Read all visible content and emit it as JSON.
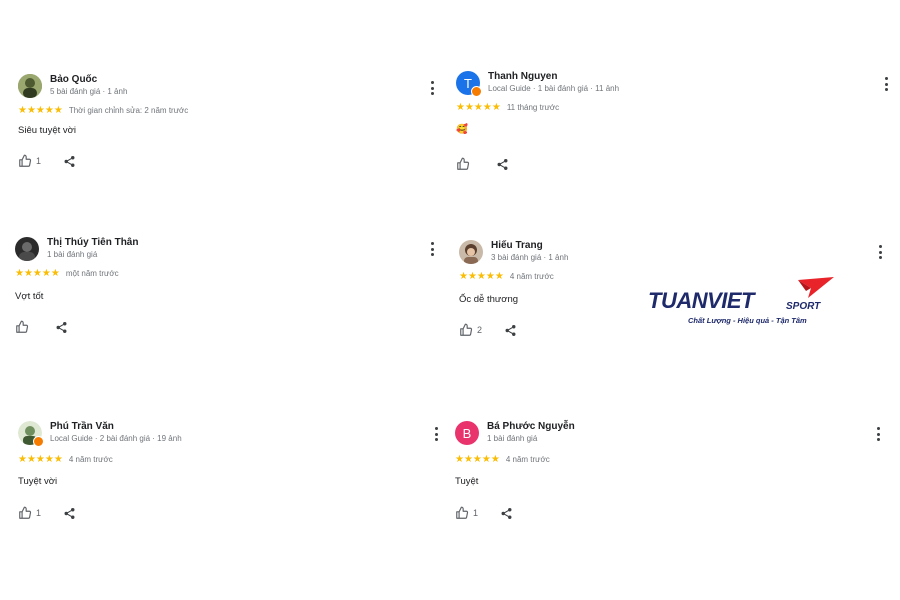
{
  "reviews": [
    {
      "name": "Bảo Quốc",
      "meta": "5 bài đánh giá · 1 ảnh",
      "stars": "★★★★★",
      "time": "Thời gian chỉnh sửa: 2 năm trước",
      "text": "Siêu tuyệt vời",
      "likes": "1",
      "avatar": {
        "type": "photo",
        "color": "#7c8a5a"
      }
    },
    {
      "name": "Thanh Nguyen",
      "meta": "Local Guide · 1 bài đánh giá · 11 ảnh",
      "stars": "★★★★★",
      "time": "11 tháng trước",
      "text": "🥰",
      "likes": "",
      "avatar": {
        "type": "letter",
        "letter": "T",
        "color": "#1a73e8"
      }
    },
    {
      "name": "Thị Thúy Tiên Thân",
      "meta": "1 bài đánh giá",
      "stars": "★★★★★",
      "time": "một năm trước",
      "text": "Vợt tốt",
      "likes": "",
      "avatar": {
        "type": "photo",
        "color": "#3a3a3a"
      }
    },
    {
      "name": "Hiếu Trang",
      "meta": "3 bài đánh giá · 1 ảnh",
      "stars": "★★★★★",
      "time": "4 năm trước",
      "text": "Ốc dễ thương",
      "likes": "2",
      "avatar": {
        "type": "photo",
        "color": "#8a6a55"
      }
    },
    {
      "name": "Phú Trần Văn",
      "meta": "Local Guide · 2 bài đánh giá · 19 ảnh",
      "stars": "★★★★★",
      "time": "4 năm trước",
      "text": "Tuyệt vời",
      "likes": "1",
      "avatar": {
        "type": "photo",
        "color": "#6f8f5f"
      }
    },
    {
      "name": "Bá Phước Nguyễn",
      "meta": "1 bài đánh giá",
      "stars": "★★★★★",
      "time": "4 năm trước",
      "text": "Tuyệt",
      "likes": "1",
      "avatar": {
        "type": "letter",
        "letter": "B",
        "color": "#e8336d"
      }
    }
  ],
  "logo": {
    "brand": "TUANVIET",
    "sport": "SPORT",
    "tagline": "Chất Lượng - Hiệu quả - Tận Tâm",
    "navy": "#1f2a6b",
    "red": "#e8232a"
  }
}
